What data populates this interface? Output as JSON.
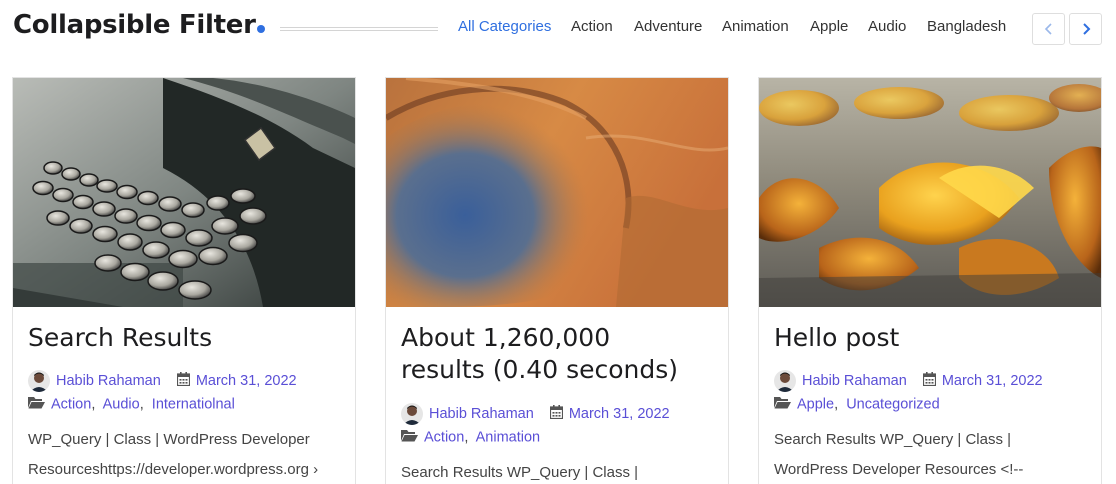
{
  "header": {
    "title": "Collapsible Filter",
    "accent_color": "#2f6fe0"
  },
  "categories": [
    {
      "label": "All Categories",
      "active": true
    },
    {
      "label": "Action"
    },
    {
      "label": "Adventure"
    },
    {
      "label": "Animation"
    },
    {
      "label": "Apple"
    },
    {
      "label": "Audio"
    },
    {
      "label": "Bangladesh"
    }
  ],
  "nav": {
    "prev_icon": "chevron-left-icon",
    "next_icon": "chevron-right-icon"
  },
  "posts": [
    {
      "image": "typewriter-photo",
      "title": "Search Results",
      "author": "Habib Rahaman",
      "date": "March 31, 2022",
      "categories": [
        "Action",
        "Audio",
        "Internatiolnal"
      ],
      "excerpt_lines": [
        "WP_Query | Class | WordPress Developer",
        "Resourceshttps://developer.wordpress.org ›"
      ]
    },
    {
      "image": "crater-photo",
      "title_lines": [
        "About 1,260,000",
        "results (0.40 seconds)"
      ],
      "author": "Habib Rahaman",
      "date": "March 31, 2022",
      "categories": [
        "Action",
        "Animation"
      ],
      "excerpt_lines": [
        "Search Results WP_Query | Class |"
      ]
    },
    {
      "image": "autumn-leaves-photo",
      "title": "Hello post",
      "author": "Habib Rahaman",
      "date": "March 31, 2022",
      "categories": [
        "Apple",
        "Uncategorized"
      ],
      "excerpt_lines": [
        "Search Results WP_Query | Class |",
        "WordPress Developer Resources <!--"
      ]
    }
  ],
  "colors": {
    "link": "#5a4fd6",
    "text": "#444444"
  }
}
